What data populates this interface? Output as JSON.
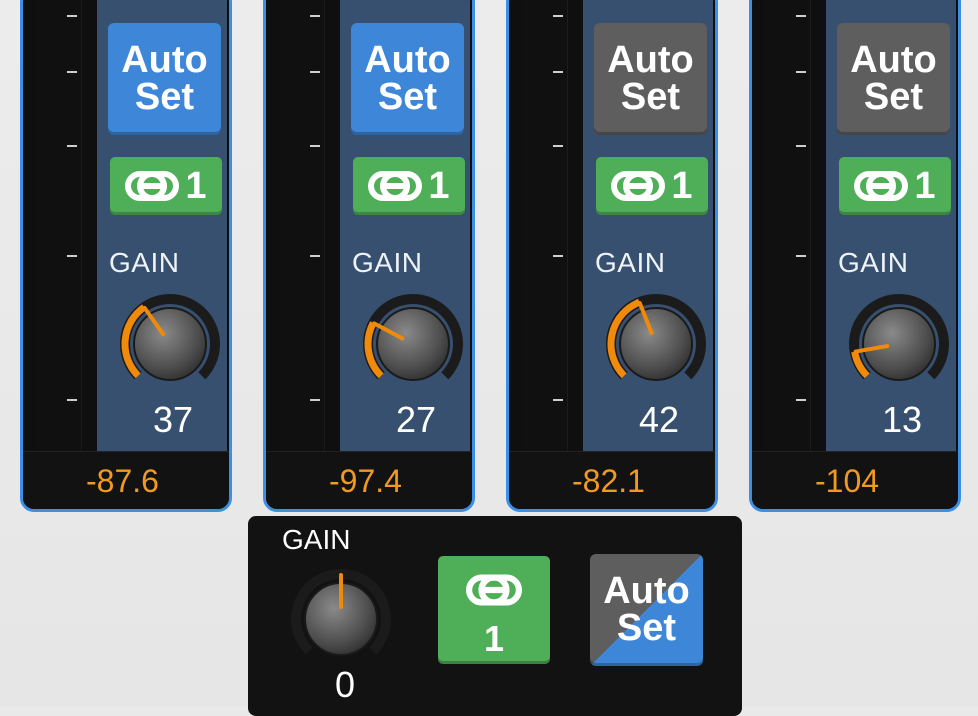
{
  "colors": {
    "accent_blue": "#3d8fe6",
    "autoset_on": "#3d86d8",
    "autoset_off": "#5e5e5e",
    "link_green": "#4fae58",
    "panel_bg": "#37506f",
    "readout_text": "#f19a1f",
    "knob_arc": "#f08a0a"
  },
  "channels": [
    {
      "autoset_line1": "Auto",
      "autoset_line2": "Set",
      "autoset_active": true,
      "link_group": "1",
      "gain_label": "GAIN",
      "gain_value": "37",
      "gain_level": 0.37,
      "readout": "-87.6"
    },
    {
      "autoset_line1": "Auto",
      "autoset_line2": "Set",
      "autoset_active": true,
      "link_group": "1",
      "gain_label": "GAIN",
      "gain_value": "27",
      "gain_level": 0.27,
      "readout": "-97.4"
    },
    {
      "autoset_line1": "Auto",
      "autoset_line2": "Set",
      "autoset_active": false,
      "link_group": "1",
      "gain_label": "GAIN",
      "gain_value": "42",
      "gain_level": 0.42,
      "readout": "-82.1"
    },
    {
      "autoset_line1": "Auto",
      "autoset_line2": "Set",
      "autoset_active": false,
      "link_group": "1",
      "gain_label": "GAIN",
      "gain_value": "13",
      "gain_level": 0.13,
      "readout": "-104"
    }
  ],
  "master": {
    "gain_label": "GAIN",
    "gain_value": "0",
    "link_group": "1",
    "autoset_line1": "Auto",
    "autoset_line2": "Set"
  },
  "icons": {
    "link": "link-icon",
    "knob": "gain-knob"
  }
}
